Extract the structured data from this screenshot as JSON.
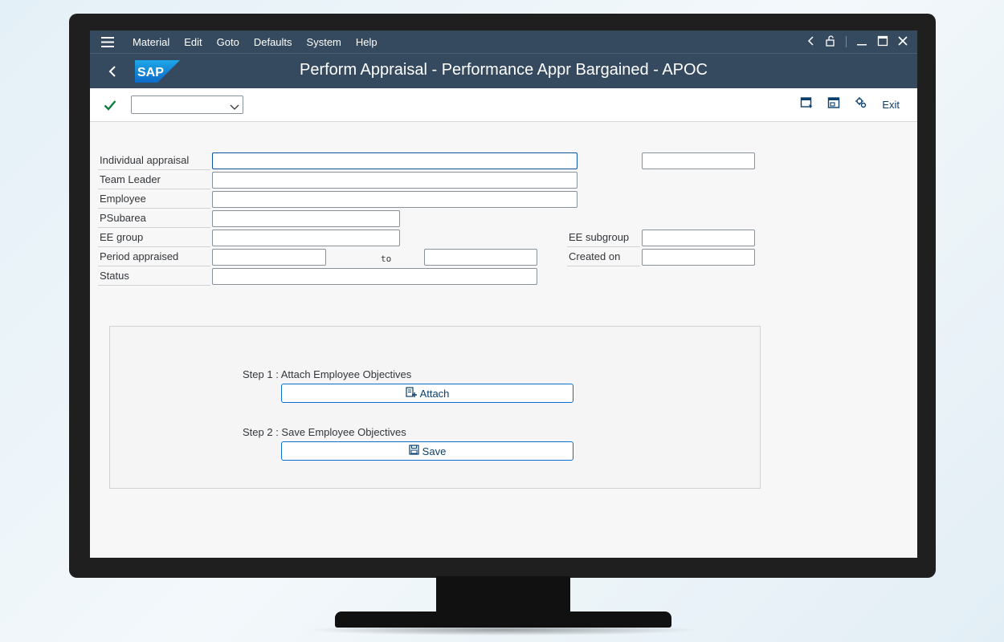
{
  "menu": {
    "items": [
      {
        "label": "Material"
      },
      {
        "label": "Edit"
      },
      {
        "label": "Goto"
      },
      {
        "label": "Defaults"
      },
      {
        "label": "System"
      },
      {
        "label": "Help"
      }
    ]
  },
  "header": {
    "logo_text": "SAP",
    "title": "Perform Appraisal - Performance Appr Bargained - APOC"
  },
  "toolbar": {
    "command_field_value": "",
    "exit_label": "Exit"
  },
  "form": {
    "individual_appraisal_label": "Individual appraisal",
    "team_leader_label": "Team Leader",
    "employee_label": "Employee",
    "psubarea_label": "PSubarea",
    "ee_group_label": "EE group",
    "ee_subgroup_label": "EE subgroup",
    "period_appraised_label": "Period appraised",
    "to_label": "to",
    "created_on_label": "Created on",
    "status_label": "Status"
  },
  "steps": {
    "step1_label": "Step 1 : Attach Employee Objectives",
    "attach_label": "Attach",
    "step2_label": "Step 2 : Save Employee Objectives",
    "save_label": "Save"
  },
  "colors": {
    "shell_header": "#354a5f",
    "accent_blue": "#0a6ed1",
    "check_green": "#107e3e"
  }
}
